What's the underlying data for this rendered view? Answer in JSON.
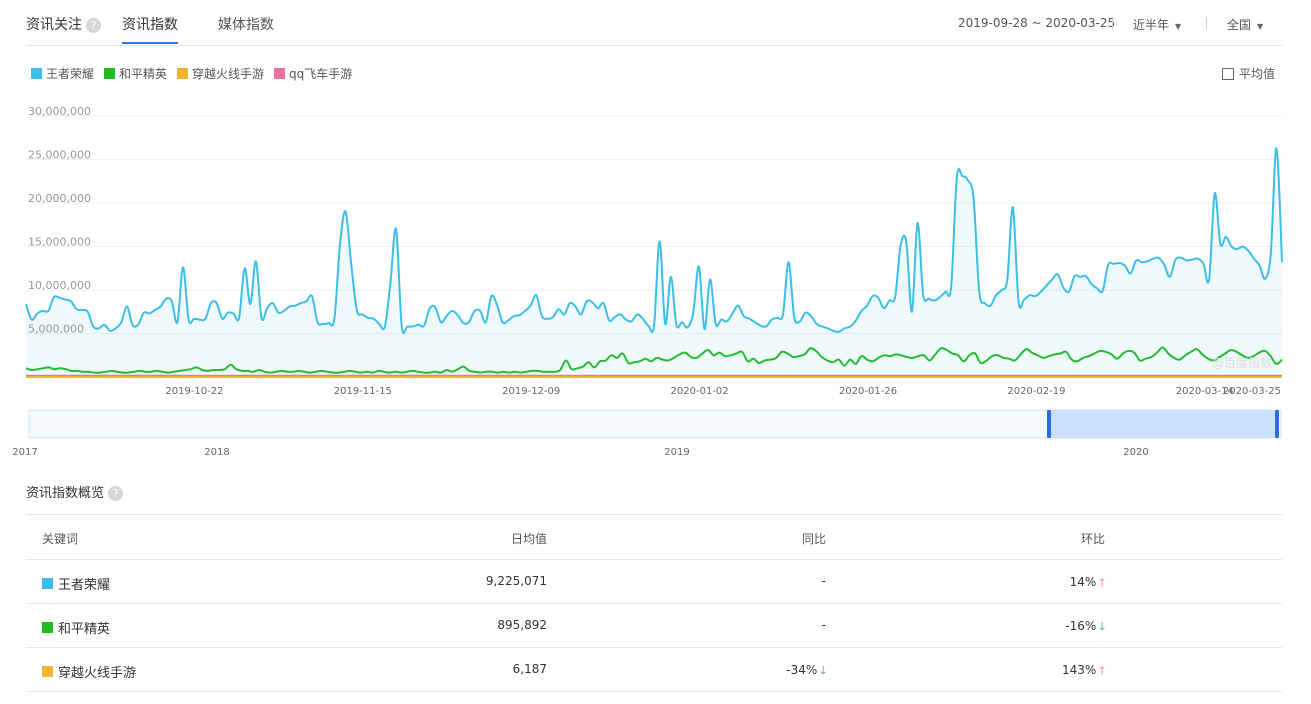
{
  "header": {
    "title": "资讯关注",
    "tabs": [
      {
        "label": "资讯指数"
      },
      {
        "label": "媒体指数"
      }
    ],
    "date_range": "2019-09-28 ~ 2020-03-25",
    "period": "近半年",
    "region": "全国"
  },
  "legend": [
    {
      "name": "王者荣耀",
      "color": "#3bbfe6"
    },
    {
      "name": "和平精英",
      "color": "#22bb22"
    },
    {
      "name": "穿越火线手游",
      "color": "#f5b332"
    },
    {
      "name": "qq飞车手游",
      "color": "#ee6fa1"
    }
  ],
  "avg_label": "平均值",
  "watermark": "@百度指数",
  "chart_data": {
    "type": "line",
    "x_start": "2019-09-28",
    "x_end": "2020-03-25",
    "ylim": [
      0,
      30000000
    ],
    "yticks": [
      "30,000,000",
      "25,000,000",
      "20,000,000",
      "15,000,000",
      "10,000,000",
      "5,000,000"
    ],
    "yvals": [
      30000000,
      25000000,
      20000000,
      15000000,
      10000000,
      5000000
    ],
    "xticks": [
      "2019-10-22",
      "2019-11-15",
      "2019-12-09",
      "2020-01-02",
      "2020-01-26",
      "2020-02-19",
      "2020-03-14",
      "2020-03-25"
    ],
    "series": [
      {
        "name": "王者荣耀",
        "color": "#3bbfe6",
        "values": [
          8400000,
          6600000,
          7300000,
          7600000,
          7600000,
          9200000,
          9100000,
          8900000,
          8700000,
          7800000,
          7700000,
          7500000,
          5800000,
          5600000,
          6000000,
          5300000,
          5600000,
          6300000,
          8100000,
          6000000,
          6000000,
          7400000,
          7300000,
          7700000,
          8100000,
          9000000,
          8700000,
          6300000,
          12600000,
          6600000,
          6700000,
          6600000,
          6700000,
          8500000,
          8500000,
          6700000,
          7400000,
          7300000,
          6800000,
          12500000,
          8400000,
          13300000,
          6800000,
          7900000,
          8500000,
          7400000,
          7600000,
          8100000,
          8200000,
          8500000,
          8700000,
          9300000,
          6300000,
          6100000,
          6200000,
          6700000,
          15300000,
          19000000,
          13000000,
          7700000,
          7200000,
          6800000,
          6700000,
          6100000,
          5800000,
          10900000,
          17000000,
          5900000,
          5800000,
          5800000,
          6000000,
          5900000,
          7900000,
          8000000,
          6300000,
          7000000,
          7600000,
          7100000,
          6200000,
          6300000,
          7600000,
          7600000,
          6300000,
          9300000,
          8300000,
          6300000,
          6500000,
          7000000,
          7100000,
          7600000,
          8200000,
          9400000,
          7000000,
          6700000,
          6900000,
          7800000,
          7200000,
          8500000,
          8100000,
          7200000,
          8700000,
          8600000,
          7900000,
          8500000,
          6500000,
          6900000,
          7200000,
          6600000,
          6400000,
          7200000,
          6700000,
          5900000,
          5900000,
          15600000,
          6100000,
          11500000,
          6000000,
          6300000,
          5700000,
          7400000,
          12700000,
          5500000,
          11200000,
          6100000,
          6600000,
          6400000,
          7300000,
          8200000,
          7000000,
          6700000,
          6300000,
          5900000,
          5800000,
          6600000,
          6800000,
          7200000,
          13200000,
          6900000,
          6400000,
          7400000,
          7000000,
          6100000,
          5800000,
          5600000,
          5300000,
          5200000,
          5600000,
          5800000,
          6500000,
          7600000,
          8200000,
          9300000,
          9100000,
          7900000,
          8800000,
          9200000,
          15200000,
          15500000,
          7500000,
          17700000,
          9500000,
          9000000,
          8800000,
          9200000,
          9800000,
          10400000,
          22900000,
          23100000,
          22600000,
          20500000,
          9800000,
          8500000,
          8200000,
          9400000,
          10000000,
          11200000,
          19500000,
          8700000,
          8900000,
          9400000,
          9300000,
          9800000,
          10500000,
          11200000,
          11800000,
          10300000,
          9800000,
          11600000,
          11500000,
          11600000,
          10700000,
          10200000,
          9900000,
          12900000,
          13000000,
          13100000,
          12800000,
          11900000,
          13400000,
          13200000,
          13300000,
          13600000,
          13700000,
          12900000,
          11500000,
          13500000,
          13700000,
          13400000,
          13500000,
          13600000,
          13000000,
          11200000,
          21100000,
          15300000,
          16100000,
          15000000,
          14700000,
          15000000,
          14500000,
          13600000,
          12800000,
          11300000,
          14200000,
          26300000,
          13200000
        ]
      },
      {
        "name": "和平精英",
        "color": "#22bb22",
        "values": [
          1000000,
          800000,
          900000,
          1000000,
          1100000,
          900000,
          1000000,
          900000,
          700000,
          700000,
          600000,
          600000,
          500000,
          500000,
          600000,
          700000,
          600000,
          500000,
          500000,
          600000,
          700000,
          600000,
          600000,
          700000,
          600000,
          500000,
          600000,
          700000,
          800000,
          900000,
          1100000,
          800000,
          700000,
          800000,
          800000,
          900000,
          1400000,
          900000,
          700000,
          700000,
          600000,
          800000,
          600000,
          500000,
          600000,
          700000,
          600000,
          600000,
          700000,
          600000,
          500000,
          600000,
          700000,
          600000,
          500000,
          500000,
          600000,
          700000,
          600000,
          500000,
          600000,
          500000,
          700000,
          600000,
          500000,
          600000,
          500000,
          600000,
          700000,
          600000,
          500000,
          500000,
          600000,
          500000,
          800000,
          600000,
          900000,
          1200000,
          700000,
          600000,
          500000,
          600000,
          600000,
          500000,
          600000,
          500000,
          600000,
          500000,
          600000,
          700000,
          700000,
          600000,
          600000,
          600000,
          800000,
          1900000,
          900000,
          1000000,
          1200000,
          1700000,
          1100000,
          1800000,
          1900000,
          2500000,
          2200000,
          2700000,
          1600000,
          1700000,
          1800000,
          2100000,
          1800000,
          2200000,
          2000000,
          1900000,
          2200000,
          2600000,
          2800000,
          2300000,
          2200000,
          2700000,
          3100000,
          2500000,
          2800000,
          2400000,
          2500000,
          2700000,
          2900000,
          1800000,
          2100000,
          1600000,
          1900000,
          2000000,
          2200000,
          2900000,
          2700000,
          2300000,
          2400000,
          2600000,
          3300000,
          3000000,
          2300000,
          1900000,
          1700000,
          2000000,
          1300000,
          2000000,
          1500000,
          2400000,
          2000000,
          1800000,
          2200000,
          2500000,
          2400000,
          2600000,
          2500000,
          2300000,
          2200000,
          2400000,
          2500000,
          1900000,
          2600000,
          3300000,
          3100000,
          2700000,
          2500000,
          1800000,
          2500000,
          2700000,
          1600000,
          1900000,
          2400000,
          2500000,
          2200000,
          2100000,
          1900000,
          2600000,
          3200000,
          2800000,
          2500000,
          2200000,
          2400000,
          2600000,
          2700000,
          2900000,
          2000000,
          1800000,
          2200000,
          2400000,
          2700000,
          3000000,
          2900000,
          2600000,
          2100000,
          2700000,
          3000000,
          2800000,
          1900000,
          2100000,
          2300000,
          2800000,
          3400000,
          2700000,
          2200000,
          2000000,
          2500000,
          2900000,
          3200000,
          2600000,
          2100000,
          1900000,
          2300000,
          2700000,
          3100000,
          2900000,
          2500000,
          2200000,
          2400000,
          2800000,
          3000000,
          2400000,
          1500000,
          2000000
        ]
      },
      {
        "name": "穿越火线手游",
        "color": "#f5b332",
        "values": [
          6000,
          6000,
          6000,
          6000,
          6000,
          6000,
          6000,
          6000,
          6000,
          6000,
          6000,
          6000
        ]
      },
      {
        "name": "qq飞车手游",
        "color": "#ee6fa1",
        "values": [
          150000,
          150000,
          150000,
          150000,
          150000,
          150000,
          150000,
          150000,
          150000,
          150000,
          150000,
          150000
        ]
      }
    ]
  },
  "timeline": {
    "labels": [
      "2017",
      "2018",
      "2019",
      "2020"
    ]
  },
  "overview": {
    "title": "资讯指数概览",
    "headers": {
      "keyword": "关键词",
      "daily_avg": "日均值",
      "yoy": "同比",
      "mom": "环比"
    },
    "rows": [
      {
        "keyword": "王者荣耀",
        "color": "#3bbfe6",
        "daily_avg": "9,225,071",
        "yoy": "-",
        "yoy_dir": "",
        "mom": "14%",
        "mom_dir": "up"
      },
      {
        "keyword": "和平精英",
        "color": "#22bb22",
        "daily_avg": "895,892",
        "yoy": "-",
        "yoy_dir": "",
        "mom": "-16%",
        "mom_dir": "down"
      },
      {
        "keyword": "穿越火线手游",
        "color": "#f5b332",
        "daily_avg": "6,187",
        "yoy": "-34%",
        "yoy_dir": "down",
        "mom": "143%",
        "mom_dir": "up"
      }
    ]
  }
}
